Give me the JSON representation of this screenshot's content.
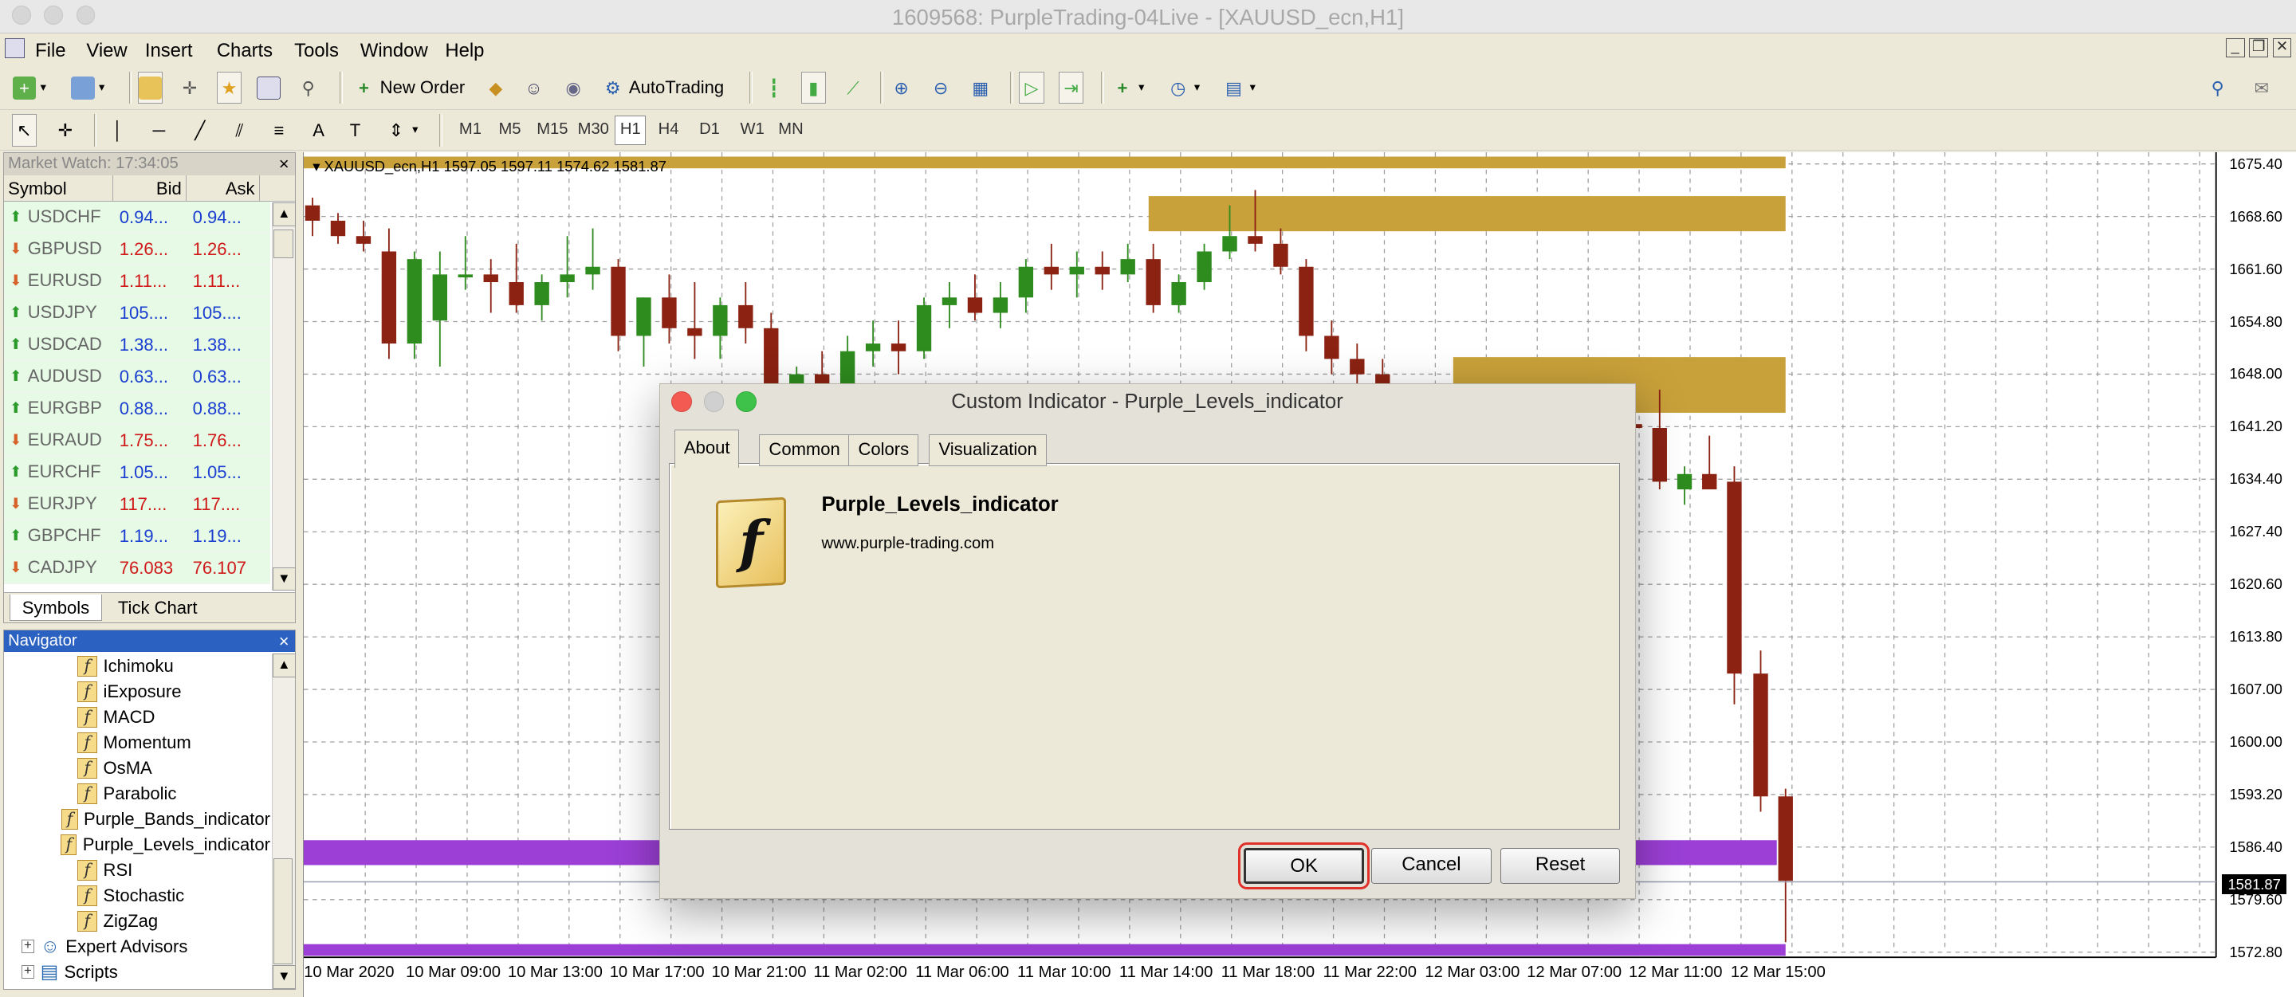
{
  "window": {
    "title": "1609568: PurpleTrading-04Live - [XAUUSD_ecn,H1]"
  },
  "menu": [
    "File",
    "View",
    "Insert",
    "Charts",
    "Tools",
    "Window",
    "Help"
  ],
  "toolbar": {
    "new_order": "New Order",
    "autotrading": "AutoTrading"
  },
  "timeframes": [
    "M1",
    "M5",
    "M15",
    "M30",
    "H1",
    "H4",
    "D1",
    "W1",
    "MN"
  ],
  "active_timeframe": "H1",
  "market_watch": {
    "title": "Market Watch: 17:34:05",
    "columns": [
      "Symbol",
      "Bid",
      "Ask"
    ],
    "rows": [
      {
        "symbol": "USDCHF",
        "bid": "0.94...",
        "ask": "0.94...",
        "dir": "up"
      },
      {
        "symbol": "GBPUSD",
        "bid": "1.26...",
        "ask": "1.26...",
        "dir": "down"
      },
      {
        "symbol": "EURUSD",
        "bid": "1.11...",
        "ask": "1.11...",
        "dir": "down"
      },
      {
        "symbol": "USDJPY",
        "bid": "105....",
        "ask": "105....",
        "dir": "up"
      },
      {
        "symbol": "USDCAD",
        "bid": "1.38...",
        "ask": "1.38...",
        "dir": "up"
      },
      {
        "symbol": "AUDUSD",
        "bid": "0.63...",
        "ask": "0.63...",
        "dir": "up"
      },
      {
        "symbol": "EURGBP",
        "bid": "0.88...",
        "ask": "0.88...",
        "dir": "up"
      },
      {
        "symbol": "EURAUD",
        "bid": "1.75...",
        "ask": "1.76...",
        "dir": "down"
      },
      {
        "symbol": "EURCHF",
        "bid": "1.05...",
        "ask": "1.05...",
        "dir": "up"
      },
      {
        "symbol": "EURJPY",
        "bid": "117....",
        "ask": "117....",
        "dir": "down"
      },
      {
        "symbol": "GBPCHF",
        "bid": "1.19...",
        "ask": "1.19...",
        "dir": "up"
      },
      {
        "symbol": "CADJPY",
        "bid": "76.083",
        "ask": "76.107",
        "dir": "down"
      }
    ],
    "tabs": [
      "Symbols",
      "Tick Chart"
    ]
  },
  "navigator": {
    "title": "Navigator",
    "indicators": [
      "Ichimoku",
      "iExposure",
      "MACD",
      "Momentum",
      "OsMA",
      "Parabolic",
      "Purple_Bands_indicator",
      "Purple_Levels_indicator",
      "RSI",
      "Stochastic",
      "ZigZag"
    ],
    "folders": [
      "Expert Advisors",
      "Scripts"
    ]
  },
  "chart": {
    "header": "XAUUSD_ecn,H1  1597.05 1597.11 1574.62 1581.87",
    "current_price": "1581.87",
    "price_labels": [
      "1675.40",
      "1668.60",
      "1661.60",
      "1654.80",
      "1648.00",
      "1641.20",
      "1634.40",
      "1627.40",
      "1620.60",
      "1613.80",
      "1607.00",
      "1600.00",
      "1593.20",
      "1586.40",
      "1579.60",
      "1572.80"
    ],
    "time_labels": [
      "10 Mar 2020",
      "10 Mar 09:00",
      "10 Mar 13:00",
      "10 Mar 17:00",
      "10 Mar 21:00",
      "11 Mar 02:00",
      "11 Mar 06:00",
      "11 Mar 10:00",
      "11 Mar 14:00",
      "11 Mar 18:00",
      "11 Mar 22:00",
      "12 Mar 03:00",
      "12 Mar 07:00",
      "12 Mar 11:00",
      "12 Mar 15:00"
    ],
    "colors": {
      "bull": "#2e8b1e",
      "bear": "#8b2212",
      "zone_gold": "#c9a13a",
      "zone_purple": "#9b3fd6"
    }
  },
  "dialog": {
    "title": "Custom Indicator - Purple_Levels_indicator",
    "tabs": [
      "About",
      "Common",
      "Colors",
      "Visualization"
    ],
    "name": "Purple_Levels_indicator",
    "url": "www.purple-trading.com",
    "ok": "OK",
    "cancel": "Cancel",
    "reset": "Reset"
  }
}
